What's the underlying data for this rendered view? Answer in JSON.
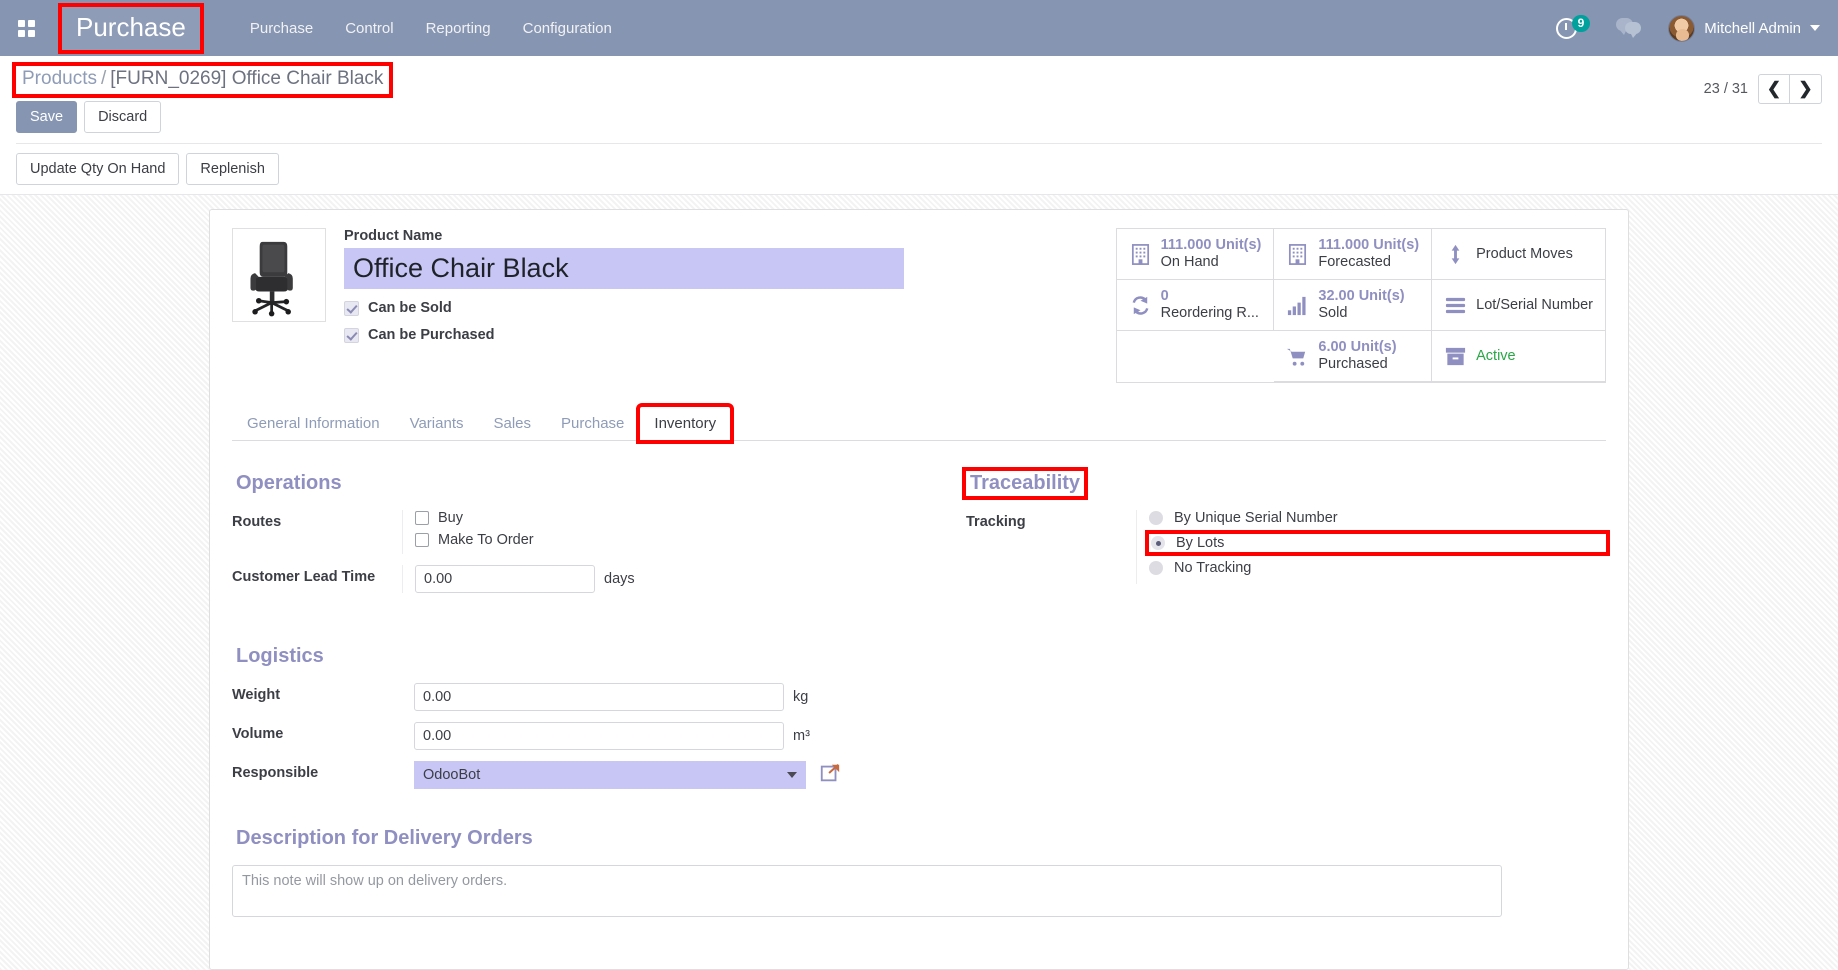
{
  "navbar": {
    "apps_icon": "apps-grid-icon",
    "brand": "Purchase",
    "menus": [
      "Purchase",
      "Control",
      "Reporting",
      "Configuration"
    ],
    "activity_icon": "clock-icon",
    "activity_count": "9",
    "messages_icon": "chat-bubbles-icon",
    "user_name": "Mitchell Admin",
    "caret_icon": "chevron-down-icon",
    "bg_color": "#8595b2"
  },
  "control_panel": {
    "breadcrumb": {
      "parent": "Products",
      "separator": "/",
      "current": "[FURN_0269] Office Chair Black"
    },
    "save_label": "Save",
    "discard_label": "Discard",
    "pager": {
      "text": "23 / 31",
      "prev_icon": "chevron-left-icon",
      "next_icon": "chevron-right-icon"
    },
    "action_buttons": [
      "Update Qty On Hand",
      "Replenish"
    ]
  },
  "product": {
    "image_alt": "office-chair-image",
    "name_label": "Product Name",
    "name_value": "Office Chair Black",
    "checkboxes": [
      {
        "label": "Can be Sold",
        "checked": true
      },
      {
        "label": "Can be Purchased",
        "checked": true
      }
    ]
  },
  "stats": [
    {
      "icon": "building-icon",
      "value": "111.000 Unit(s)",
      "label": "On Hand"
    },
    {
      "icon": "building-icon",
      "value": "111.000 Unit(s)",
      "label": "Forecasted"
    },
    {
      "icon": "arrows-vertical-icon",
      "value": "",
      "label": "Product Moves"
    },
    {
      "icon": "refresh-icon",
      "value": "0",
      "label": "Reordering R..."
    },
    {
      "icon": "bar-chart-icon",
      "value": "32.00 Unit(s)",
      "label": "Sold"
    },
    {
      "icon": "list-bars-icon",
      "value": "",
      "label": "Lot/Serial Number"
    },
    {
      "icon": "",
      "value": "",
      "label": ""
    },
    {
      "icon": "cart-icon",
      "value": "6.00 Unit(s)",
      "label": "Purchased"
    },
    {
      "icon": "archive-icon",
      "value": "",
      "label": "Active",
      "green": true
    }
  ],
  "tabs": [
    {
      "label": "General Information",
      "active": false
    },
    {
      "label": "Variants",
      "active": false
    },
    {
      "label": "Sales",
      "active": false
    },
    {
      "label": "Purchase",
      "active": false
    },
    {
      "label": "Inventory",
      "active": true
    }
  ],
  "operations": {
    "title": "Operations",
    "routes_label": "Routes",
    "routes": [
      {
        "label": "Buy",
        "checked": false
      },
      {
        "label": "Make To Order",
        "checked": false
      }
    ],
    "lead_time_label": "Customer Lead Time",
    "lead_time_value": "0.00",
    "lead_time_unit": "days"
  },
  "traceability": {
    "title": "Traceability",
    "tracking_label": "Tracking",
    "options": [
      {
        "label": "By Unique Serial Number",
        "selected": false
      },
      {
        "label": "By Lots",
        "selected": true
      },
      {
        "label": "No Tracking",
        "selected": false
      }
    ]
  },
  "logistics": {
    "title": "Logistics",
    "weight_label": "Weight",
    "weight_value": "0.00",
    "weight_unit": "kg",
    "volume_label": "Volume",
    "volume_value": "0.00",
    "volume_unit": "m³",
    "responsible_label": "Responsible",
    "responsible_value": "OdooBot",
    "external_link_icon": "external-link-icon"
  },
  "description": {
    "title": "Description for Delivery Orders",
    "placeholder": "This note will show up on delivery orders."
  }
}
